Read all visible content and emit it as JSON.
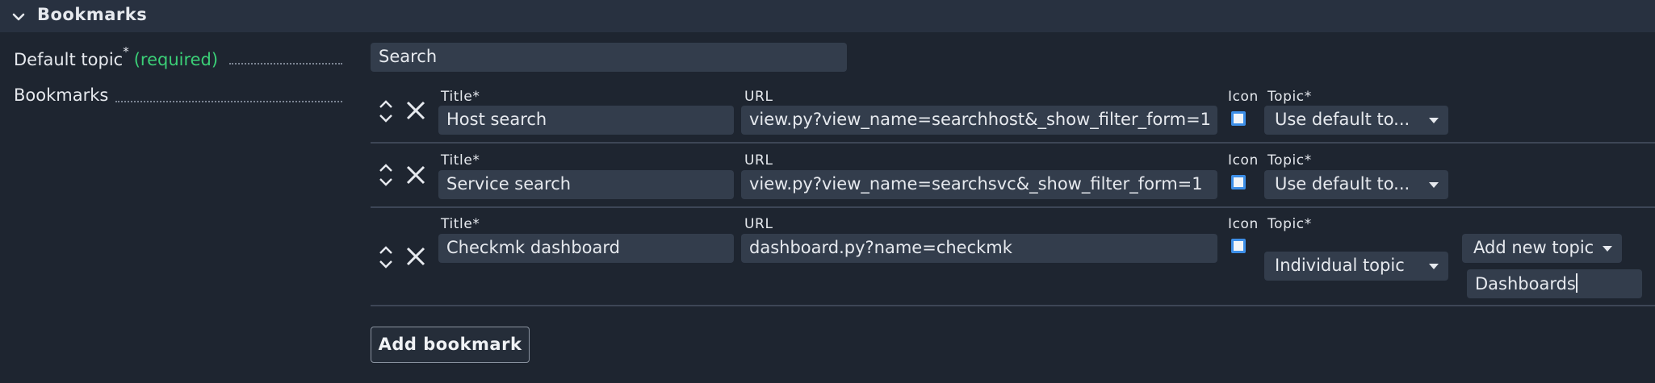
{
  "section": {
    "title": "Bookmarks"
  },
  "default_topic": {
    "label": "Default topic",
    "required_marker": "*",
    "required_text": "(required)",
    "value": "Search"
  },
  "bookmarks_label": "Bookmarks",
  "column_labels": {
    "title": "Title*",
    "url": "URL",
    "icon": "Icon",
    "topic": "Topic*"
  },
  "rows": [
    {
      "title": "Host search",
      "url": "view.py?view_name=searchhost&_show_filter_form=1",
      "topic": "Use default to..."
    },
    {
      "title": "Service search",
      "url": "view.py?view_name=searchsvc&_show_filter_form=1",
      "topic": "Use default to..."
    },
    {
      "title": "Checkmk dashboard",
      "url": "dashboard.py?name=checkmk",
      "topic": "Individual topic",
      "new_topic_mode": "Add new topic",
      "new_topic_value": "Dashboards"
    }
  ],
  "add_button": "Add bookmark",
  "icons": {
    "collapse": "chevron-down-icon",
    "reorder": "updown-arrows-icon",
    "delete": "close-icon"
  },
  "colors": {
    "background": "#1e2530",
    "header": "#283140",
    "field": "#333d4c",
    "required": "#3bcf77",
    "checkbox": "#3d8fe8"
  }
}
